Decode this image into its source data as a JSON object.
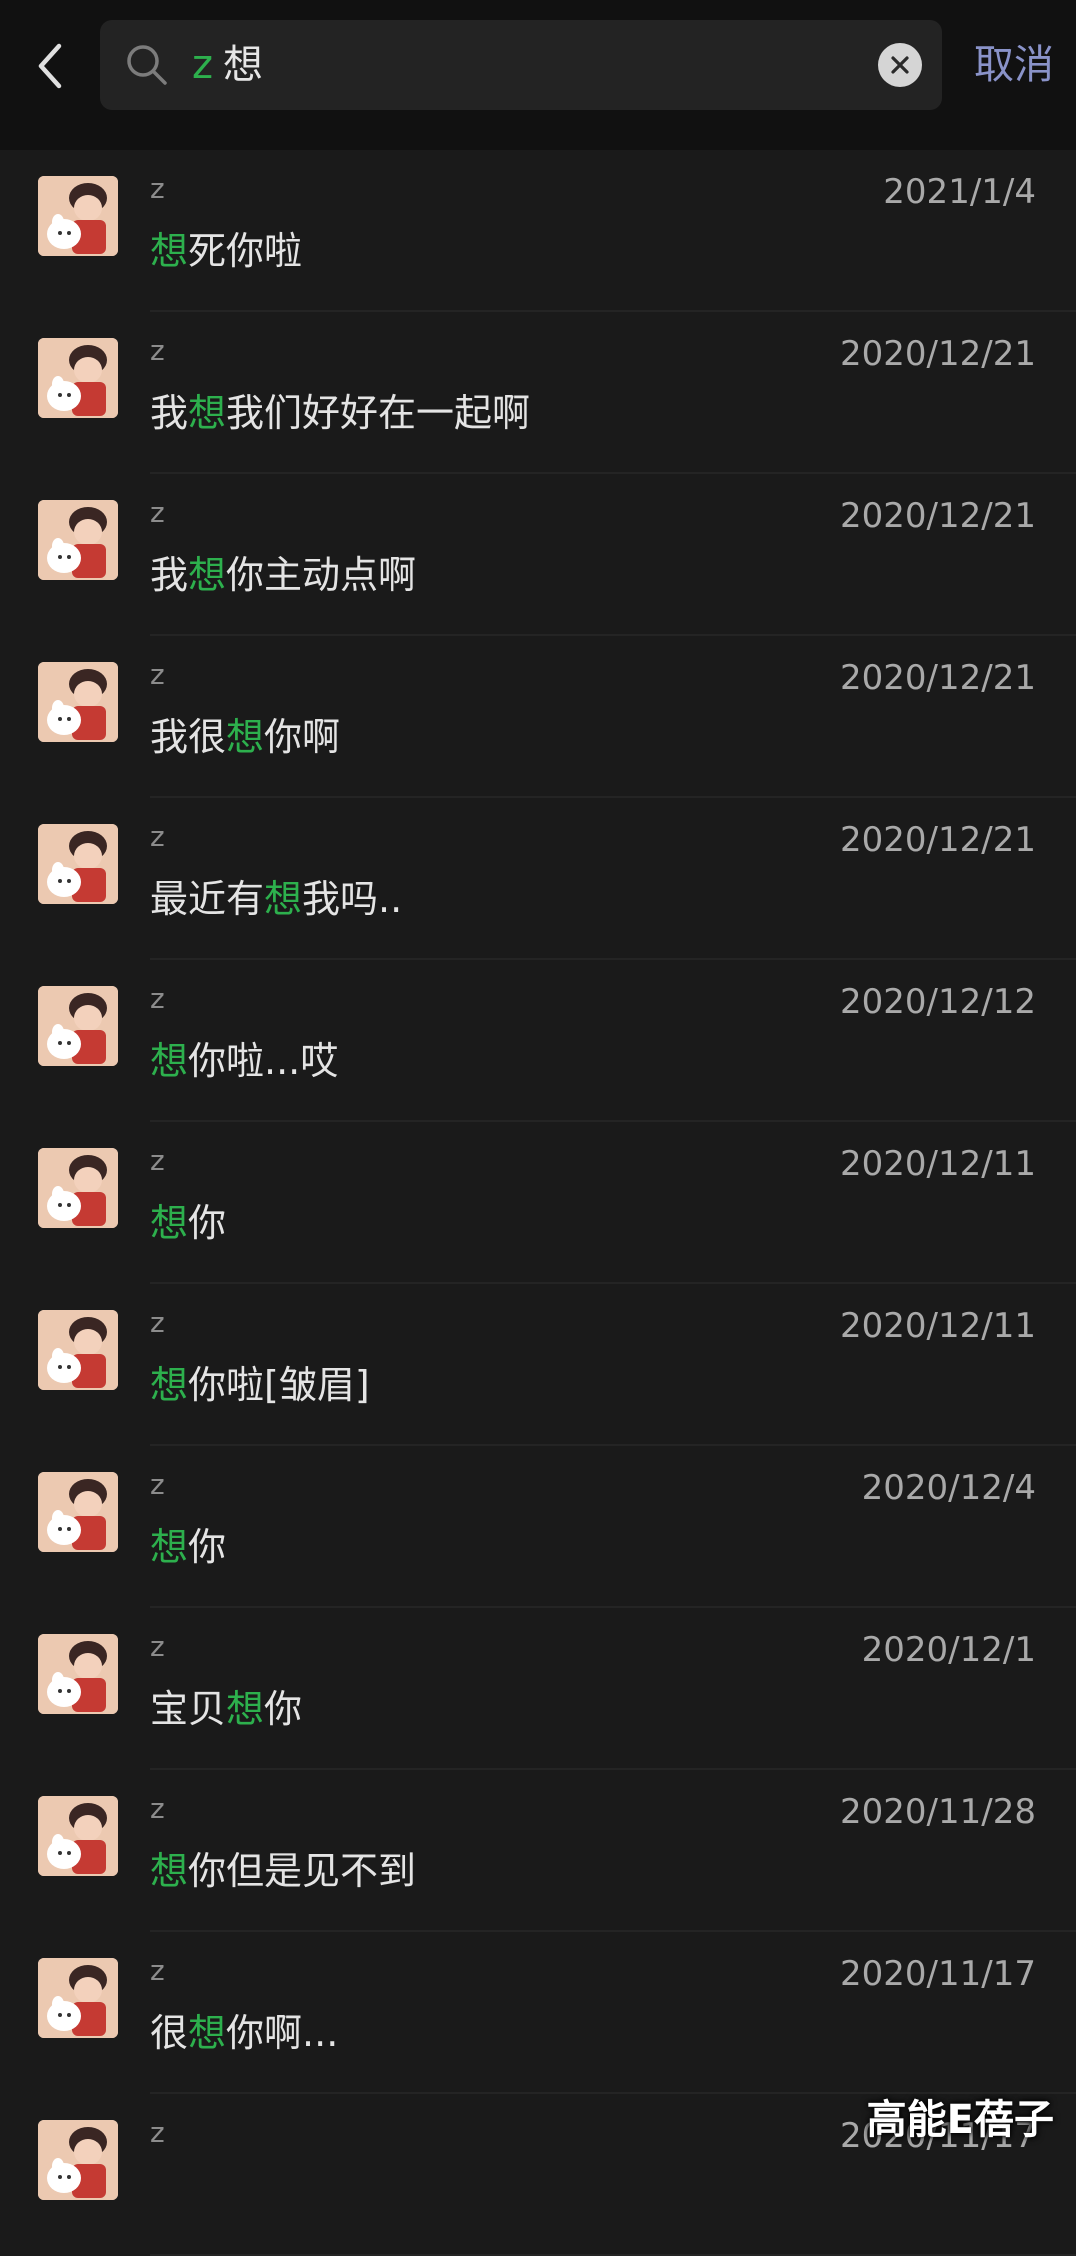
{
  "header": {
    "back_icon": "chevron-left-icon",
    "search_icon": "search-icon",
    "query_keyword": "z",
    "query_text": "想",
    "clear_icon": "close-icon",
    "cancel_label": "取消"
  },
  "colors": {
    "highlight": "#2db04d",
    "cancel": "#8a93c9",
    "background": "#1a1a1a"
  },
  "results": [
    {
      "name": "z",
      "date": "2021/1/4",
      "pre": "",
      "hl": "想",
      "post": "死你啦"
    },
    {
      "name": "z",
      "date": "2020/12/21",
      "pre": "我",
      "hl": "想",
      "post": "我们好好在一起啊"
    },
    {
      "name": "z",
      "date": "2020/12/21",
      "pre": "我",
      "hl": "想",
      "post": "你主动点啊"
    },
    {
      "name": "z",
      "date": "2020/12/21",
      "pre": "我很",
      "hl": "想",
      "post": "你啊"
    },
    {
      "name": "z",
      "date": "2020/12/21",
      "pre": "最近有",
      "hl": "想",
      "post": "我吗.."
    },
    {
      "name": "z",
      "date": "2020/12/12",
      "pre": "",
      "hl": "想",
      "post": "你啦...哎"
    },
    {
      "name": "z",
      "date": "2020/12/11",
      "pre": "",
      "hl": "想",
      "post": "你"
    },
    {
      "name": "z",
      "date": "2020/12/11",
      "pre": "",
      "hl": "想",
      "post": "你啦[皱眉]"
    },
    {
      "name": "z",
      "date": "2020/12/4",
      "pre": "",
      "hl": "想",
      "post": "你"
    },
    {
      "name": "z",
      "date": "2020/12/1",
      "pre": "宝贝",
      "hl": "想",
      "post": "你"
    },
    {
      "name": "z",
      "date": "2020/11/28",
      "pre": "",
      "hl": "想",
      "post": "你但是见不到"
    },
    {
      "name": "z",
      "date": "2020/11/17",
      "pre": "很",
      "hl": "想",
      "post": "你啊..."
    },
    {
      "name": "z",
      "date": "2020/11/17",
      "pre": "",
      "hl": "",
      "post": ""
    }
  ],
  "watermark": "高能E蓓子"
}
